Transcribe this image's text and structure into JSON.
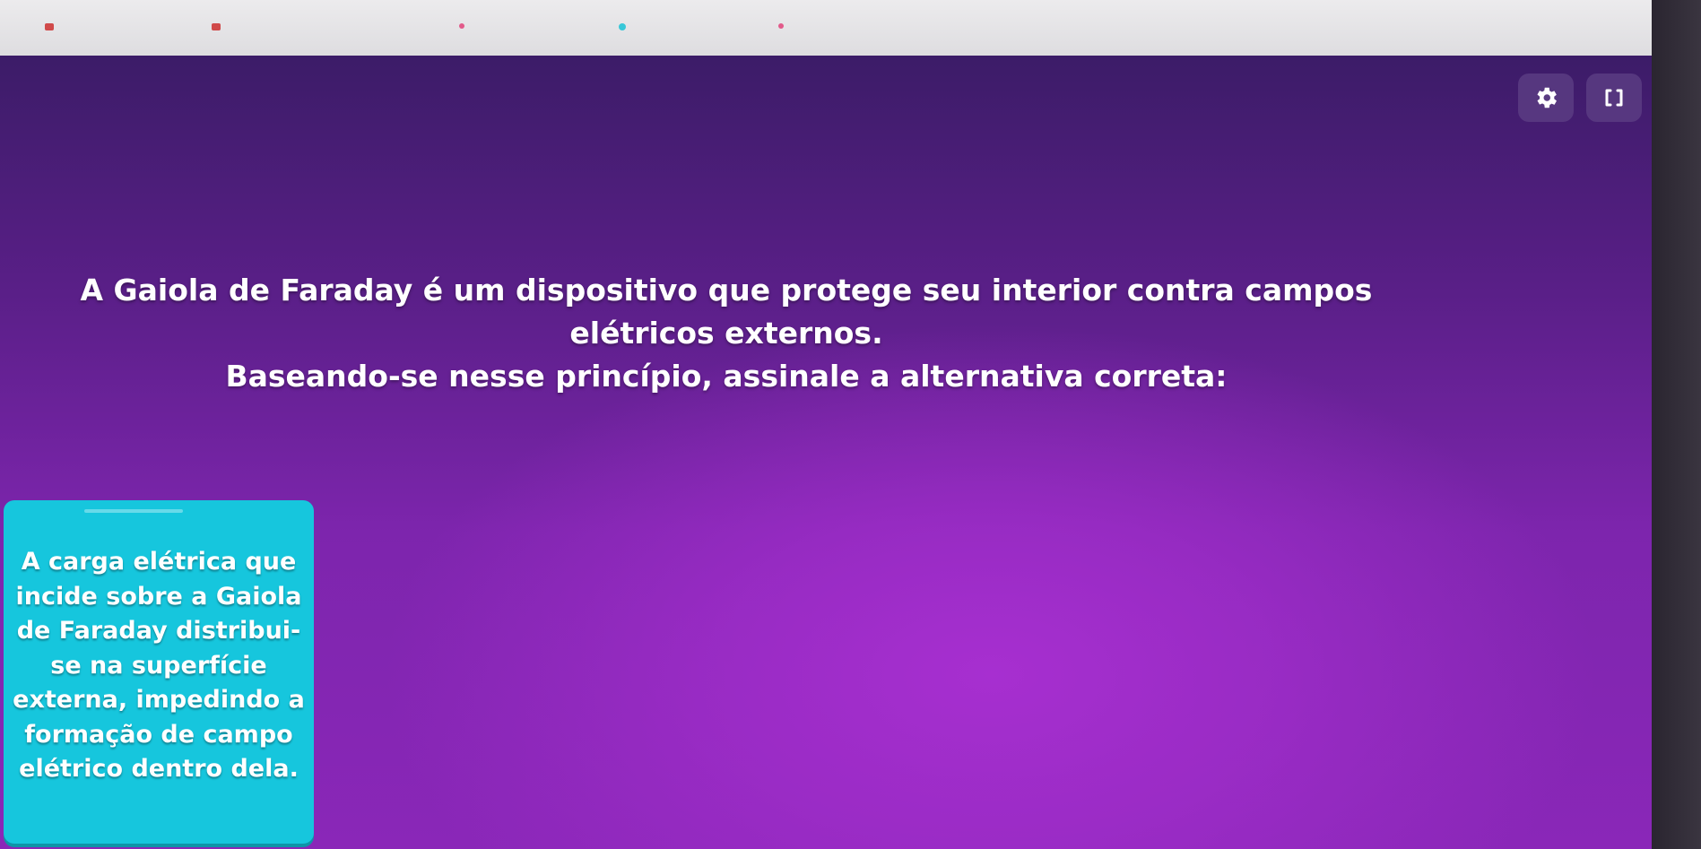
{
  "question": {
    "line1": "A Gaiola de Faraday é um dispositivo que protege seu interior contra campos elétricos externos.",
    "line2": "Baseando-se nesse princípio, assinale a alternativa correta:"
  },
  "answers": [
    {
      "text": "A carga elétrica que incide sobre a Gaiola de Faraday distribui-se na superfície externa, impedindo a formação de campo elétrico dentro dela.",
      "color": "#16c6dd"
    }
  ],
  "controls": {
    "settings_icon": "gear-icon",
    "fullscreen_icon": "fullscreen-icon"
  },
  "colors": {
    "background_top": "#3c1c68",
    "background_bottom": "#a72fd0",
    "button_bg": "#5a3c82"
  }
}
